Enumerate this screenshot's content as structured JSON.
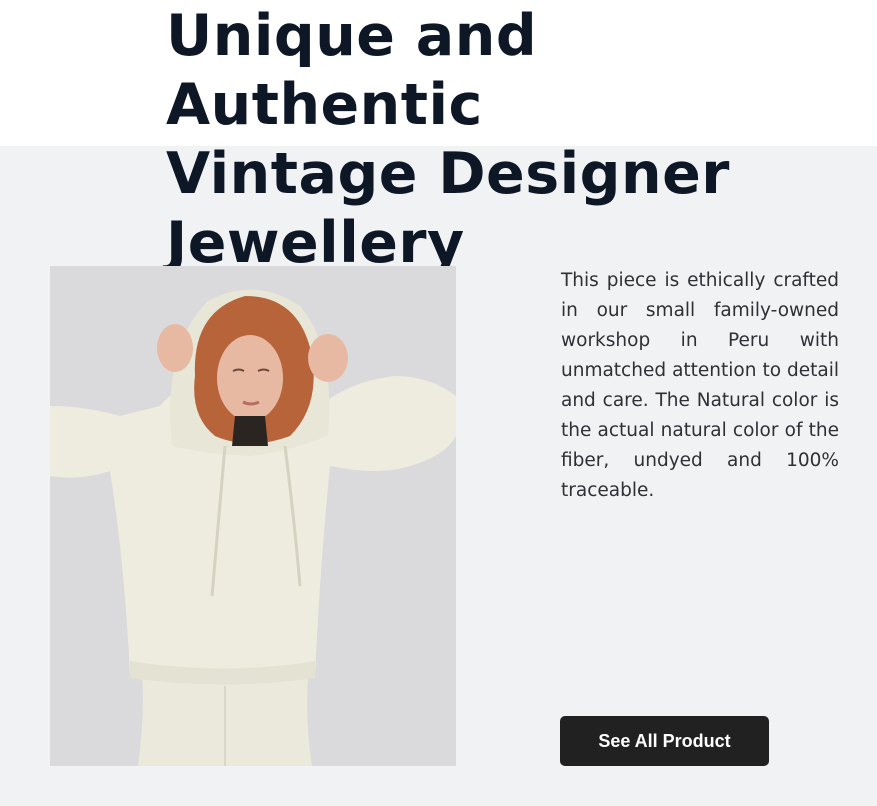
{
  "hero": {
    "title": "Unique and Authentic\nVintage Designer\nJewellery"
  },
  "product": {
    "image_alt": "Model wearing a natural cream knit hoodie",
    "description": "This piece is ethically crafted in our small family-owned workshop in Peru with unmatched attention to detail and care. The Natural color is the actual natural color of the fiber, undyed and 100% traceable.",
    "cta_label": "See All Product"
  },
  "colors": {
    "heading": "#0e1726",
    "background_band": "#f1f2f4",
    "button": "#212121",
    "photo_backdrop": "#dadadc"
  }
}
